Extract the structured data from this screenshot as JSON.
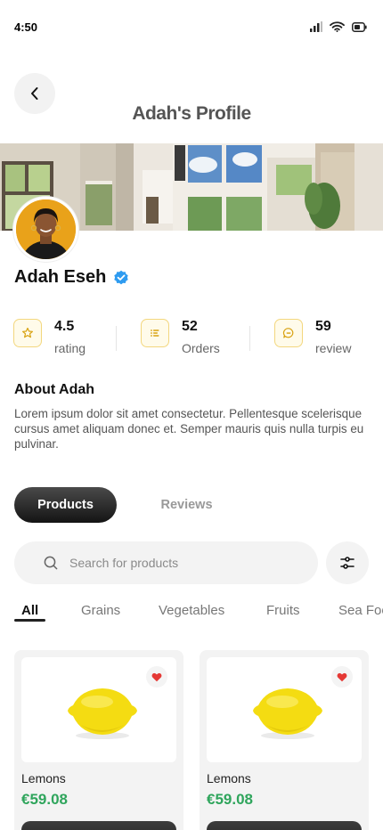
{
  "status_bar": {
    "time": "4:50"
  },
  "header": {
    "title": "Adah's Profile"
  },
  "profile": {
    "name": "Adah Eseh",
    "verified": true
  },
  "stats": [
    {
      "value": "4.5",
      "label": "rating",
      "icon": "star-icon"
    },
    {
      "value": "52",
      "label": "Orders",
      "icon": "list-icon"
    },
    {
      "value": "59",
      "label": "review",
      "icon": "chat-icon"
    }
  ],
  "about": {
    "title": "About Adah",
    "text": "Lorem ipsum dolor sit amet consectetur. Pellentesque scelerisque cursus amet aliquam donec et. Semper mauris quis nulla turpis eu pulvinar."
  },
  "tabs": {
    "products": "Products",
    "reviews": "Reviews",
    "active": "products"
  },
  "search": {
    "placeholder": "Search for products",
    "value": ""
  },
  "categories": [
    "All",
    "Grains",
    "Vegetables",
    "Fruits",
    "Sea Food"
  ],
  "active_category": "All",
  "products": [
    {
      "name": "Lemons",
      "price": "€59.08",
      "favorite": true
    },
    {
      "name": "Lemons",
      "price": "€59.08",
      "favorite": true
    }
  ],
  "colors": {
    "accent_yellow": "#f3d77e",
    "price_green": "#2fa55c",
    "verified_blue": "#2e9bf0",
    "heart_red": "#e53935"
  }
}
